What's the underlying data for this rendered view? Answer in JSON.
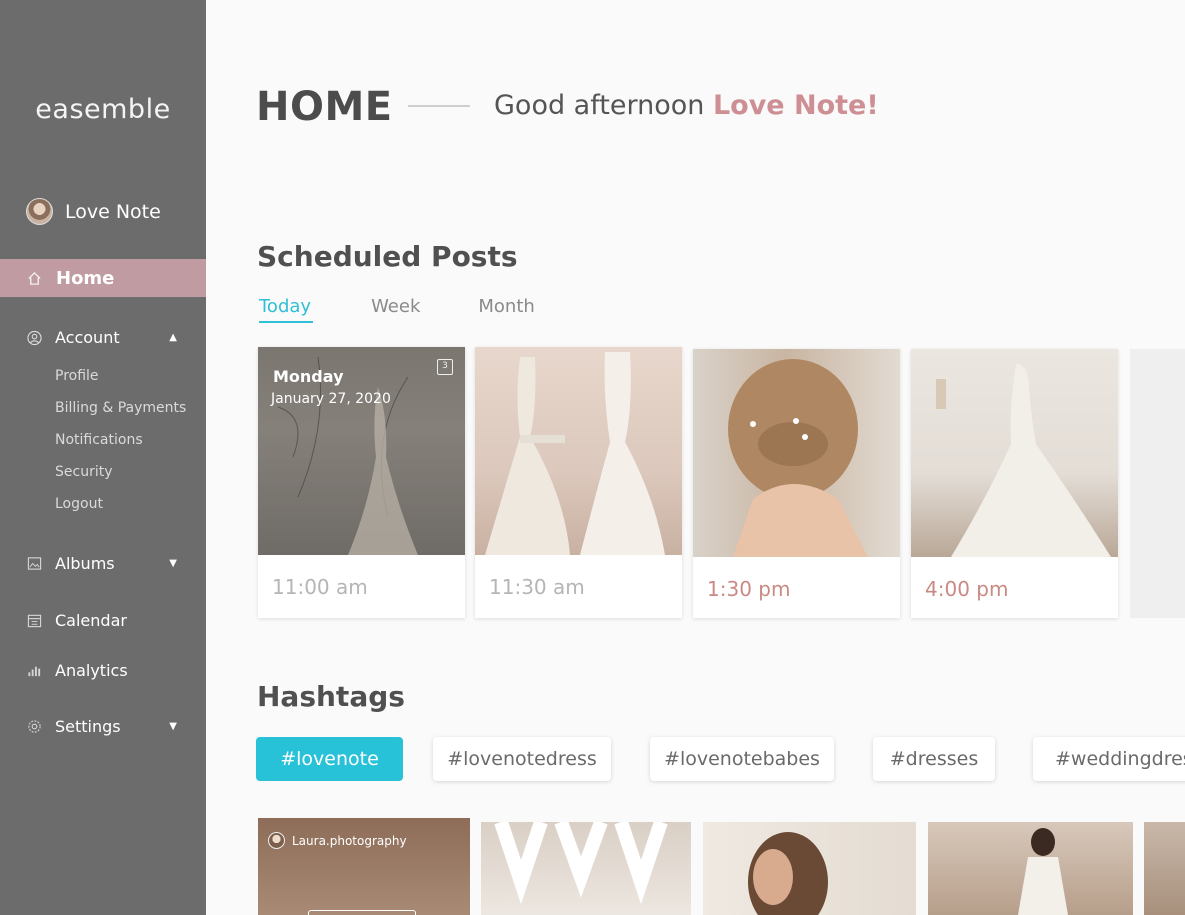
{
  "sidebar": {
    "brand": "easemble",
    "user_name": "Love Note",
    "home_label": "Home",
    "account_label": "Account",
    "account_sub": [
      "Profile",
      "Billing & Payments",
      "Notifications",
      "Security",
      "Logout"
    ],
    "albums_label": "Albums",
    "calendar_label": "Calendar",
    "analytics_label": "Analytics",
    "settings_label": "Settings"
  },
  "header": {
    "title": "HOME",
    "greeting": "Good afternoon ",
    "greeting_name": "Love Note!"
  },
  "scheduled": {
    "title": "Scheduled Posts",
    "tabs": [
      "Today",
      "Week",
      "Month"
    ],
    "active_tab": "Today",
    "posts": [
      {
        "day": "Monday",
        "date": "January 27, 2020",
        "time": "11:00 am",
        "count": "3"
      },
      {
        "time": "11:30 am"
      },
      {
        "time": "1:30 pm"
      },
      {
        "time": "4:00 pm"
      }
    ]
  },
  "hashtags": {
    "title": "Hashtags",
    "tags": [
      "#lovenote",
      "#lovenotedress",
      "#lovenotebabes",
      "#dresses",
      "#weddingdres"
    ],
    "active_tag": "#lovenote",
    "credit": "Laura.photography"
  },
  "colors": {
    "sidebar": "#6c6c6c",
    "nav_active": "#c09ca2",
    "accent_pink": "#cd8f93",
    "accent_cyan": "#27c1d8"
  }
}
